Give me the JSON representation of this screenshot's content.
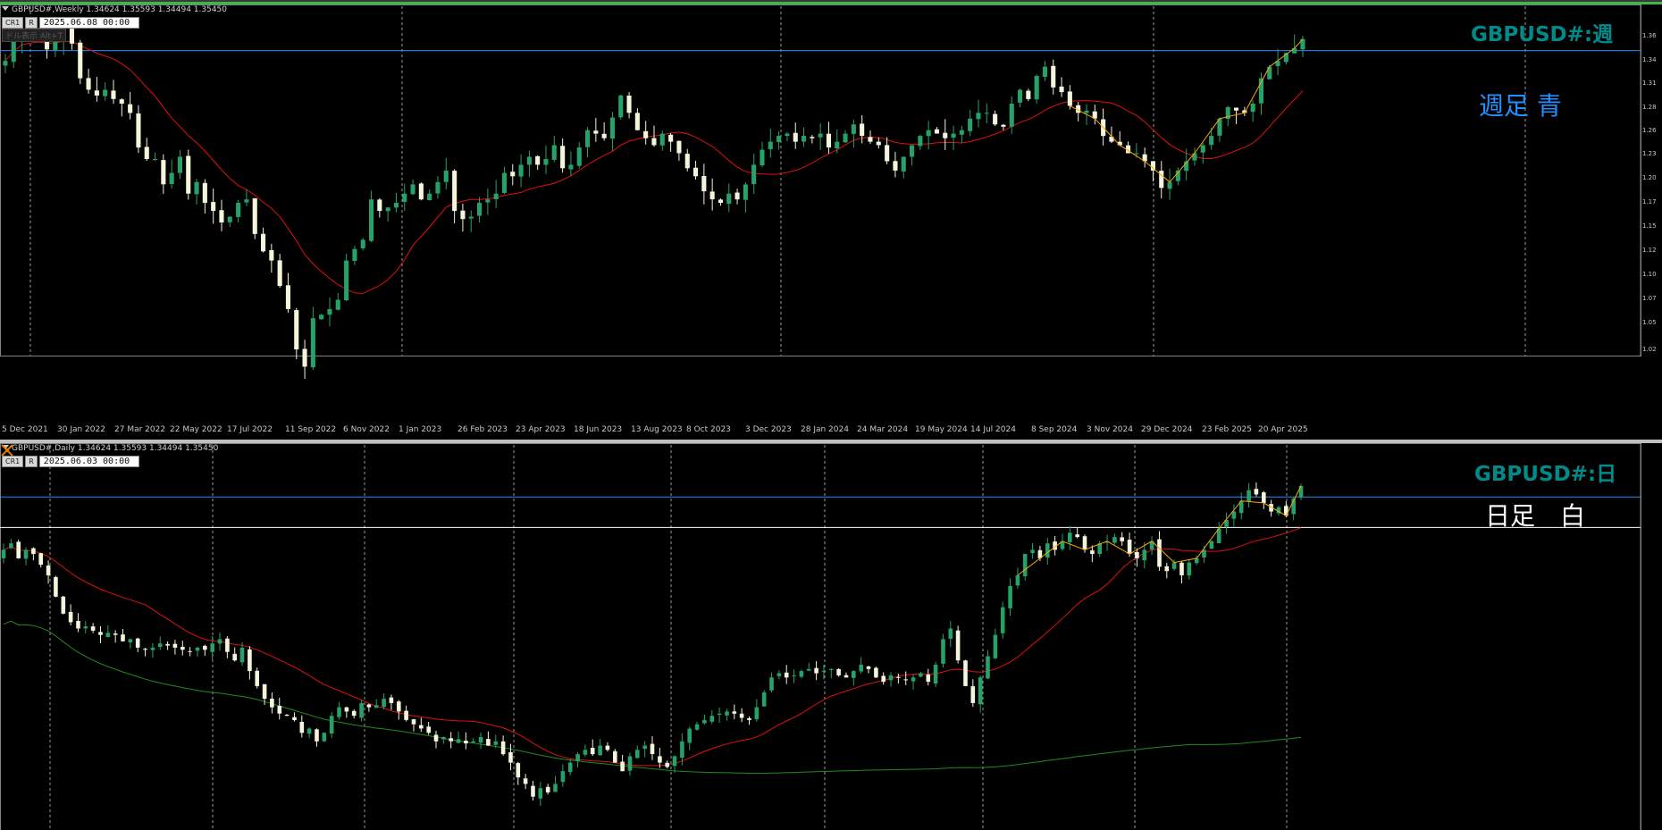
{
  "top": {
    "header": "GBPUSD#,Weekly  1.34624 1.35593 1.34494 1.35450",
    "btn_cr": "CR1",
    "btn_r": "R",
    "date_input": "2025.06.08 00:00",
    "hint": "ドル表示 Alt+T",
    "symbol_label": "GBPUSD#:週",
    "note_label": "週足 青",
    "note_color": "#1e90ff"
  },
  "bottom": {
    "header": "GBPUSD#,Daily  1.34624 1.35593 1.34494 1.35450",
    "btn_cr": "CR1",
    "btn_r": "R",
    "date_input": "2025.06.03 00:00",
    "symbol_label": "GBPUSD#:日",
    "note_label": "日足　白",
    "note_color": "#ffffff"
  },
  "colors": {
    "bull": "#26a269",
    "bear": "#f5f5dc",
    "ma_red": "#e01010",
    "ma_green": "#208a20",
    "zigzag": "#ffa500",
    "hline_blue": "#1e90ff",
    "hline_white": "#ffffff",
    "symbol": "#008b8b"
  },
  "chart_data": [
    {
      "type": "candlestick",
      "title": "GBPUSD#,Weekly",
      "x_tick_labels": [
        "5 Dec 2021",
        "30 Jan 2022",
        "27 Mar 2022",
        "22 May 2022",
        "17 Jul 2022",
        "11 Sep 2022",
        "6 Nov 2022",
        "1 Jan 2023",
        "26 Feb 2023",
        "23 Apr 2023",
        "18 Jun 2023",
        "13 Aug 2023",
        "8 Oct 2023",
        "3 Dec 2023",
        "28 Jan 2024",
        "24 Mar 2024",
        "19 May 2024",
        "14 Jul 2024",
        "8 Sep 2024",
        "3 Nov 2024",
        "29 Dec 2024",
        "23 Feb 2025",
        "20 Apr 2025"
      ],
      "y_tick_labels": [
        "1.36",
        "1.34",
        "1.31",
        "1.28",
        "1.26",
        "1.23",
        "1.20",
        "1.17",
        "1.15",
        "1.12",
        "1.10",
        "1.07",
        "1.05",
        "1.02"
      ],
      "ylim": [
        1.02,
        1.37
      ],
      "ohlc_last": {
        "open": 1.34624,
        "high": 1.35593,
        "low": 1.34494,
        "close": 1.3545
      },
      "close_path": [
        1.335,
        1.352,
        1.36,
        1.355,
        1.355,
        1.345,
        1.352,
        1.362,
        1.35,
        1.32,
        1.31,
        1.305,
        1.31,
        1.302,
        1.298,
        1.29,
        1.26,
        1.25,
        1.25,
        1.228,
        1.238,
        1.252,
        1.22,
        1.23,
        1.212,
        1.205,
        1.195,
        1.2,
        1.212,
        1.215,
        1.185,
        1.17,
        1.162,
        1.14,
        1.12,
        1.085,
        1.07,
        1.112,
        1.115,
        1.12,
        1.128,
        1.162,
        1.172,
        1.18,
        1.215,
        1.205,
        1.208,
        1.212,
        1.22,
        1.228,
        1.215,
        1.22,
        1.23,
        1.24,
        1.205,
        1.198,
        1.2,
        1.212,
        1.215,
        1.22,
        1.238,
        1.235,
        1.245,
        1.252,
        1.245,
        1.25,
        1.262,
        1.242,
        1.245,
        1.26,
        1.275,
        1.272,
        1.268,
        1.286,
        1.305,
        1.29,
        1.275,
        1.268,
        1.262,
        1.272,
        1.265,
        1.255,
        1.242,
        1.235,
        1.222,
        1.215,
        1.212,
        1.22,
        1.215,
        1.228,
        1.245,
        1.258,
        1.265,
        1.27,
        1.272,
        1.265,
        1.27,
        1.268,
        1.272,
        1.26,
        1.265,
        1.272,
        1.28,
        1.27,
        1.265,
        1.262,
        1.248,
        1.24,
        1.252,
        1.262,
        1.27,
        1.275,
        1.272,
        1.268,
        1.272,
        1.275,
        1.285,
        1.29,
        1.29,
        1.28,
        1.278,
        1.298,
        1.31,
        1.302,
        1.322,
        1.33,
        1.312,
        1.308,
        1.296,
        1.29,
        1.292,
        1.285,
        1.27,
        1.265,
        1.262,
        1.255,
        1.255,
        1.248,
        1.24,
        1.225,
        1.23,
        1.24,
        1.248,
        1.255,
        1.262,
        1.27,
        1.285,
        1.295,
        1.292,
        1.29,
        1.298,
        1.32,
        1.33,
        1.335,
        1.342,
        1.346,
        1.354
      ]
    },
    {
      "type": "candlestick",
      "title": "GBPUSD#,Daily",
      "ohlc_last": {
        "open": 1.34624,
        "high": 1.35593,
        "low": 1.34494,
        "close": 1.3545
      },
      "ylim": [
        1.2,
        1.37
      ],
      "close_path": [
        1.322,
        1.325,
        1.318,
        1.322,
        1.32,
        1.315,
        1.31,
        1.3,
        1.292,
        1.288,
        1.285,
        1.286,
        1.284,
        1.282,
        1.283,
        1.282,
        1.279,
        1.28,
        1.276,
        1.275,
        1.276,
        1.278,
        1.277,
        1.276,
        1.275,
        1.274,
        1.276,
        1.275,
        1.278,
        1.28,
        1.274,
        1.27,
        1.276,
        1.265,
        1.258,
        1.252,
        1.248,
        1.245,
        1.244,
        1.242,
        1.236,
        1.238,
        1.232,
        1.236,
        1.244,
        1.248,
        1.246,
        1.244,
        1.25,
        1.248,
        1.249,
        1.252,
        1.25,
        1.246,
        1.242,
        1.24,
        1.238,
        1.236,
        1.232,
        1.234,
        1.232,
        1.233,
        1.231,
        1.232,
        1.234,
        1.23,
        1.232,
        1.226,
        1.222,
        1.215,
        1.212,
        1.206,
        1.21,
        1.208,
        1.212,
        1.218,
        1.222,
        1.226,
        1.228,
        1.226,
        1.23,
        1.228,
        1.222,
        1.218,
        1.225,
        1.228,
        1.23,
        1.226,
        1.222,
        1.22,
        1.225,
        1.232,
        1.238,
        1.24,
        1.242,
        1.244,
        1.245,
        1.246,
        1.245,
        1.243,
        1.242,
        1.248,
        1.255,
        1.262,
        1.264,
        1.262,
        1.263,
        1.265,
        1.266,
        1.264,
        1.265,
        1.266,
        1.263,
        1.262,
        1.265,
        1.268,
        1.266,
        1.262,
        1.26,
        1.263,
        1.262,
        1.261,
        1.262,
        1.264,
        1.26,
        1.268,
        1.28,
        1.285,
        1.27,
        1.258,
        1.25,
        1.262,
        1.272,
        1.282,
        1.295,
        1.305,
        1.31,
        1.32,
        1.322,
        1.318,
        1.325,
        1.322,
        1.326,
        1.33,
        1.328,
        1.322,
        1.32,
        1.325,
        1.326,
        1.328,
        1.326,
        1.32,
        1.318,
        1.322,
        1.326,
        1.314,
        1.312,
        1.316,
        1.31,
        1.316,
        1.318,
        1.322,
        1.326,
        1.332,
        1.336,
        1.34,
        1.345,
        1.35,
        1.348,
        1.344,
        1.34,
        1.342,
        1.338,
        1.346,
        1.352
      ]
    }
  ]
}
